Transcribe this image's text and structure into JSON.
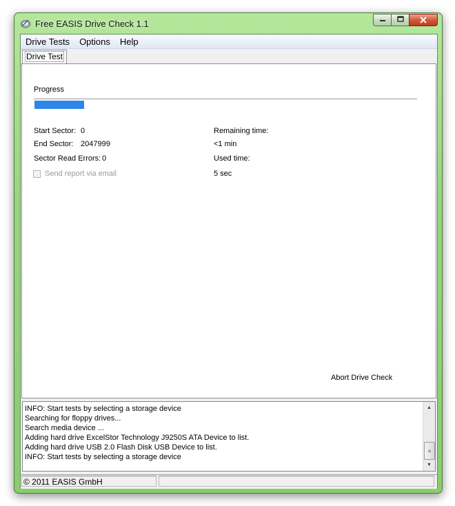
{
  "window": {
    "title": "Free EASIS Drive Check 1.1",
    "accent_color": "#97d67c",
    "icons": {
      "app": "drive-check-icon",
      "minimize": "minimize-icon",
      "maximize": "maximize-icon",
      "close": "close-icon"
    }
  },
  "menu": {
    "items": [
      "Drive Tests",
      "Options",
      "Help"
    ]
  },
  "tabs": [
    "Drive Test"
  ],
  "drive_test": {
    "progress_label": "Progress",
    "progress_fraction": 0.13,
    "progress_color": "#2d86ea",
    "start_sector_label": "Start Sector:",
    "start_sector_value": "0",
    "end_sector_label": "End Sector:",
    "end_sector_value": "2047999",
    "sector_read_errors_label": "Sector Read Errors:",
    "sector_read_errors_value": "0",
    "send_report_label": "Send report via email",
    "send_report_checked": false,
    "remaining_time_label": "Remaining time:",
    "remaining_time_value": "<1 min",
    "used_time_label": "Used time:",
    "used_time_value": "5 sec",
    "abort_label": "Abort Drive Check"
  },
  "log": {
    "lines": [
      "INFO: Start tests by selecting a storage device",
      "Searching for floppy drives...",
      "Search media device ...",
      "Adding hard drive ExcelStor Technology J9250S ATA Device to list.",
      "Adding hard drive USB 2.0 Flash Disk USB Device to list.",
      "INFO: Start tests by selecting a storage device"
    ]
  },
  "status": {
    "copyright": "© 2011 EASIS GmbH"
  }
}
